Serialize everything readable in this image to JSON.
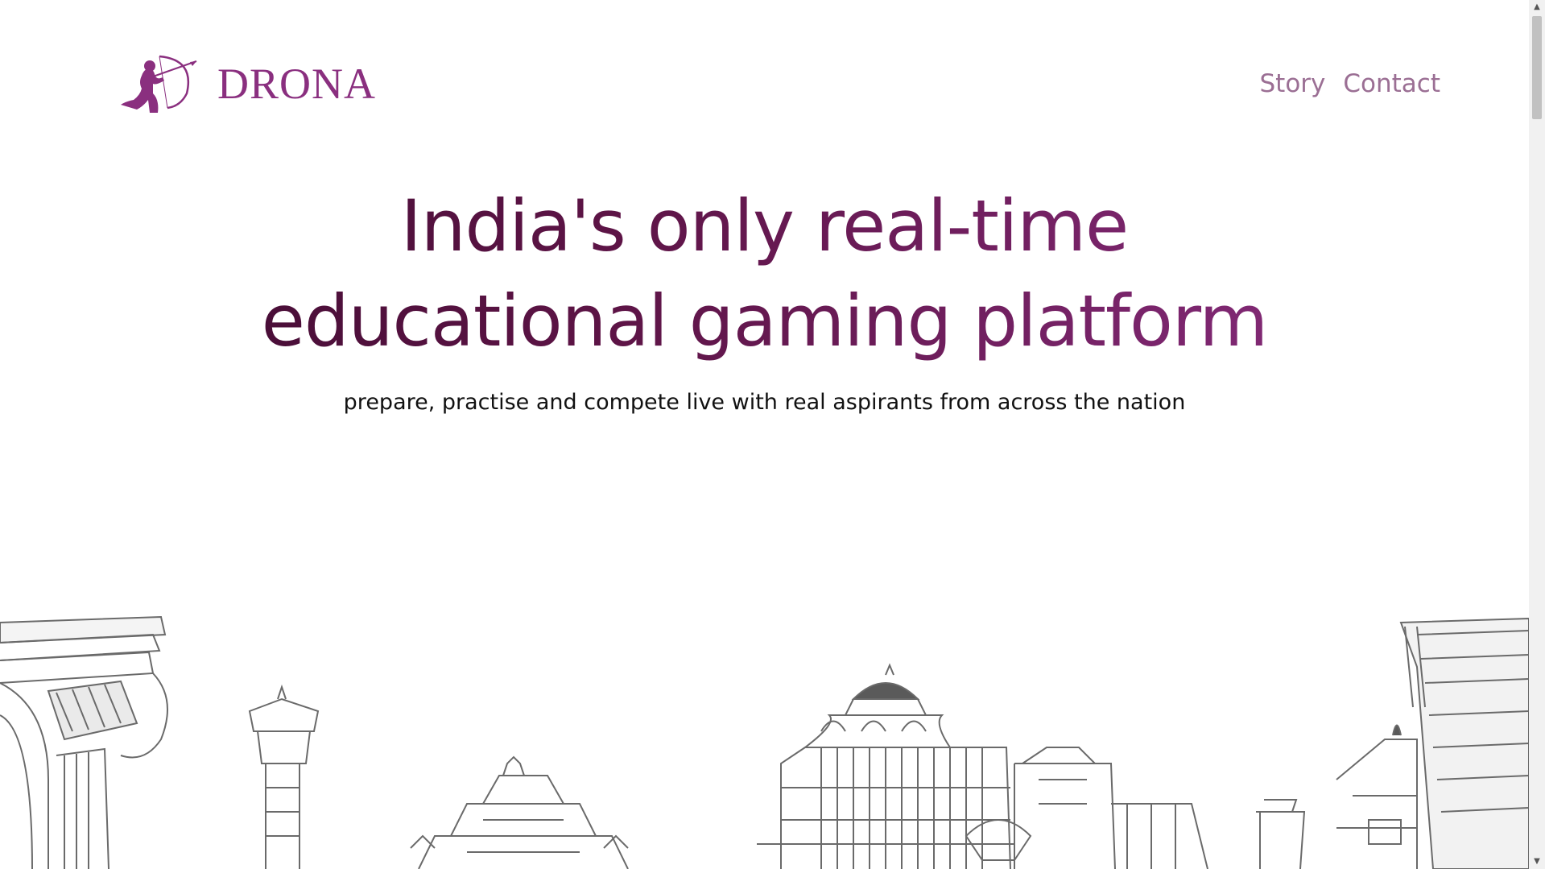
{
  "brand": {
    "name": "DRONA",
    "accent": "#8a2f7f"
  },
  "nav": {
    "items": [
      {
        "label": "Story"
      },
      {
        "label": "Contact"
      }
    ]
  },
  "hero": {
    "title_line1": "India's only real-time",
    "title_line2": "educational gaming platform",
    "subtitle": "prepare, practise and compete live with real aspirants from across the nation"
  },
  "icons": {
    "logo": "archer-icon",
    "scroll_up": "arrow-up-icon",
    "scroll_down": "arrow-down-icon"
  },
  "colors": {
    "nav_text": "#9b6f94",
    "title_gradient_start": "#3c0a2e",
    "title_gradient_end": "#8e3085",
    "subtitle": "#111111",
    "sketch": "#555555"
  }
}
